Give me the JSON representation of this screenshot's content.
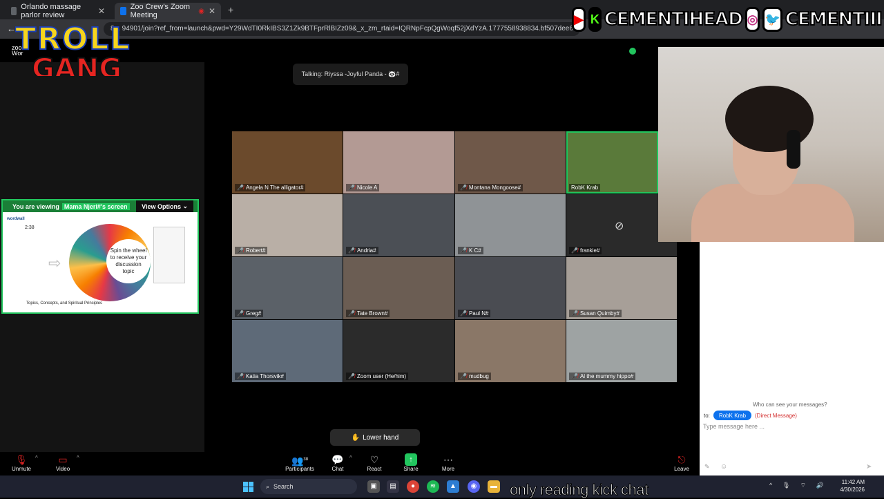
{
  "browser": {
    "tabs": [
      {
        "label": "Orlando massage parlor review"
      },
      {
        "label": "Zoo Crew's Zoom Meeting"
      }
    ],
    "new_tab_label": "+",
    "url": "8 .. 94901/join?ref_from=launch&pwd=Y29WdTI0RkIBS3Z1Zk9BTFprRlBIZz09&_x_zm_rtaid=IQRNpFcpQgWoqf52jXdYzA.1777558938834.bf507dee6f677f00"
  },
  "overlay": {
    "logo_line1": "TROLL",
    "logo_line2": "GANG",
    "handle_kick": "CEMENTIHEAD",
    "handle_social": "CEMENTIII",
    "caption": "only reading kick chat"
  },
  "zoom": {
    "brand_small": "zoom",
    "brand_small2": "Wor",
    "talking": "Talking: Riyssa -Joyful Panda - 🐼#",
    "share": {
      "viewing_prefix": "You are viewing",
      "viewing_name": "Mama Njeri#'s screen",
      "view_options": "View Options",
      "timer": "2:38",
      "wheel_text": "Spin the wheel to receive your discussion topic",
      "footer": "Topics, Concepts, and Spiritual Principles",
      "site_logo": "wordwall"
    },
    "participants": [
      {
        "name": "Angela N The alligator#",
        "bg": "#6b4a2c"
      },
      {
        "name": "Nicole A",
        "bg": "#b39a94"
      },
      {
        "name": "Montana Mongoose#",
        "bg": "#6f5849"
      },
      {
        "name": "RobK Krab",
        "bg": "#5a7a3a"
      },
      {
        "name": "Robert#",
        "bg": "#b9afa6"
      },
      {
        "name": "Andria#",
        "bg": "#4b4f55"
      },
      {
        "name": "K C#",
        "bg": "#8f9396"
      },
      {
        "name": "frankie#",
        "bg": "#2a2a2a"
      },
      {
        "name": "Greg#",
        "bg": "#5b6168"
      },
      {
        "name": "Tate Brown#",
        "bg": "#6b5d53"
      },
      {
        "name": "Paul N#",
        "bg": "#4a4c52"
      },
      {
        "name": "Susan Quimby#",
        "bg": "#a79f98"
      },
      {
        "name": "Katia Thorsvik#",
        "bg": "#5e6a78"
      },
      {
        "name": "Zoom user (He/him)",
        "bg": "#2b2b2b"
      },
      {
        "name": "mudbug",
        "bg": "#8a7767"
      },
      {
        "name": "Al the mummy hippo#",
        "bg": "#9ea3a3"
      }
    ],
    "lower_hand": "Lower hand",
    "toolbar": {
      "unmute": "Unmute",
      "video": "Video",
      "participants": "Participants",
      "participants_count": "38",
      "chat": "Chat",
      "react": "React",
      "share": "Share",
      "more": "More",
      "leave": "Leave"
    },
    "chat": {
      "who_can_see": "Who can see your messages?",
      "to_label": "to:",
      "recipient": "RobK Krab",
      "dm_tag": "(Direct Message)",
      "placeholder": "Type message here ..."
    }
  },
  "taskbar": {
    "search": "Search",
    "time": "11:42 AM",
    "date": "4/30/2026"
  },
  "colors": {
    "zoom_green": "#22c55e",
    "zoom_blue": "#0e72ed",
    "mic_red": "#e02424"
  }
}
